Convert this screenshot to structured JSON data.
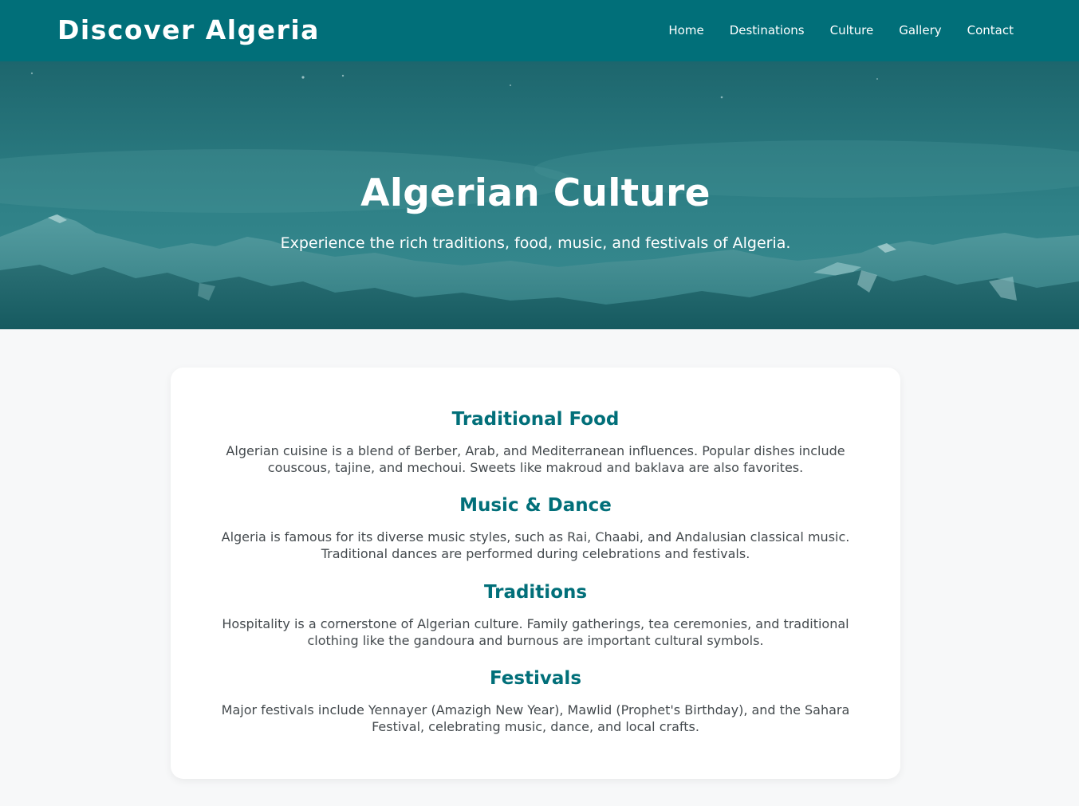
{
  "site": {
    "brand": "Discover Algeria",
    "nav": [
      "Home",
      "Destinations",
      "Culture",
      "Gallery",
      "Contact"
    ]
  },
  "hero": {
    "title": "Algerian Culture",
    "subtitle": "Experience the rich traditions, food, music, and festivals of Algeria."
  },
  "sections": [
    {
      "heading": "Traditional Food",
      "text": "Algerian cuisine is a blend of Berber, Arab, and Mediterranean influences. Popular dishes include couscous, tajine, and mechoui. Sweets like makroud and baklava are also favorites."
    },
    {
      "heading": "Music & Dance",
      "text": "Algeria is famous for its diverse music styles, such as Rai, Chaabi, and Andalusian classical music. Traditional dances are performed during celebrations and festivals."
    },
    {
      "heading": "Traditions",
      "text": "Hospitality is a cornerstone of Algerian culture. Family gatherings, tea ceremonies, and traditional clothing like the gandoura and burnous are important cultural symbols."
    },
    {
      "heading": "Festivals",
      "text": "Major festivals include Yennayer (Amazigh New Year), Mawlid (Prophet's Birthday), and the Sahara Festival, celebrating music, dance, and local crafts."
    }
  ],
  "colors": {
    "primary": "#016f79",
    "page_background": "#f7f8f9",
    "card_background": "#ffffff",
    "body_text": "#444a4e"
  }
}
